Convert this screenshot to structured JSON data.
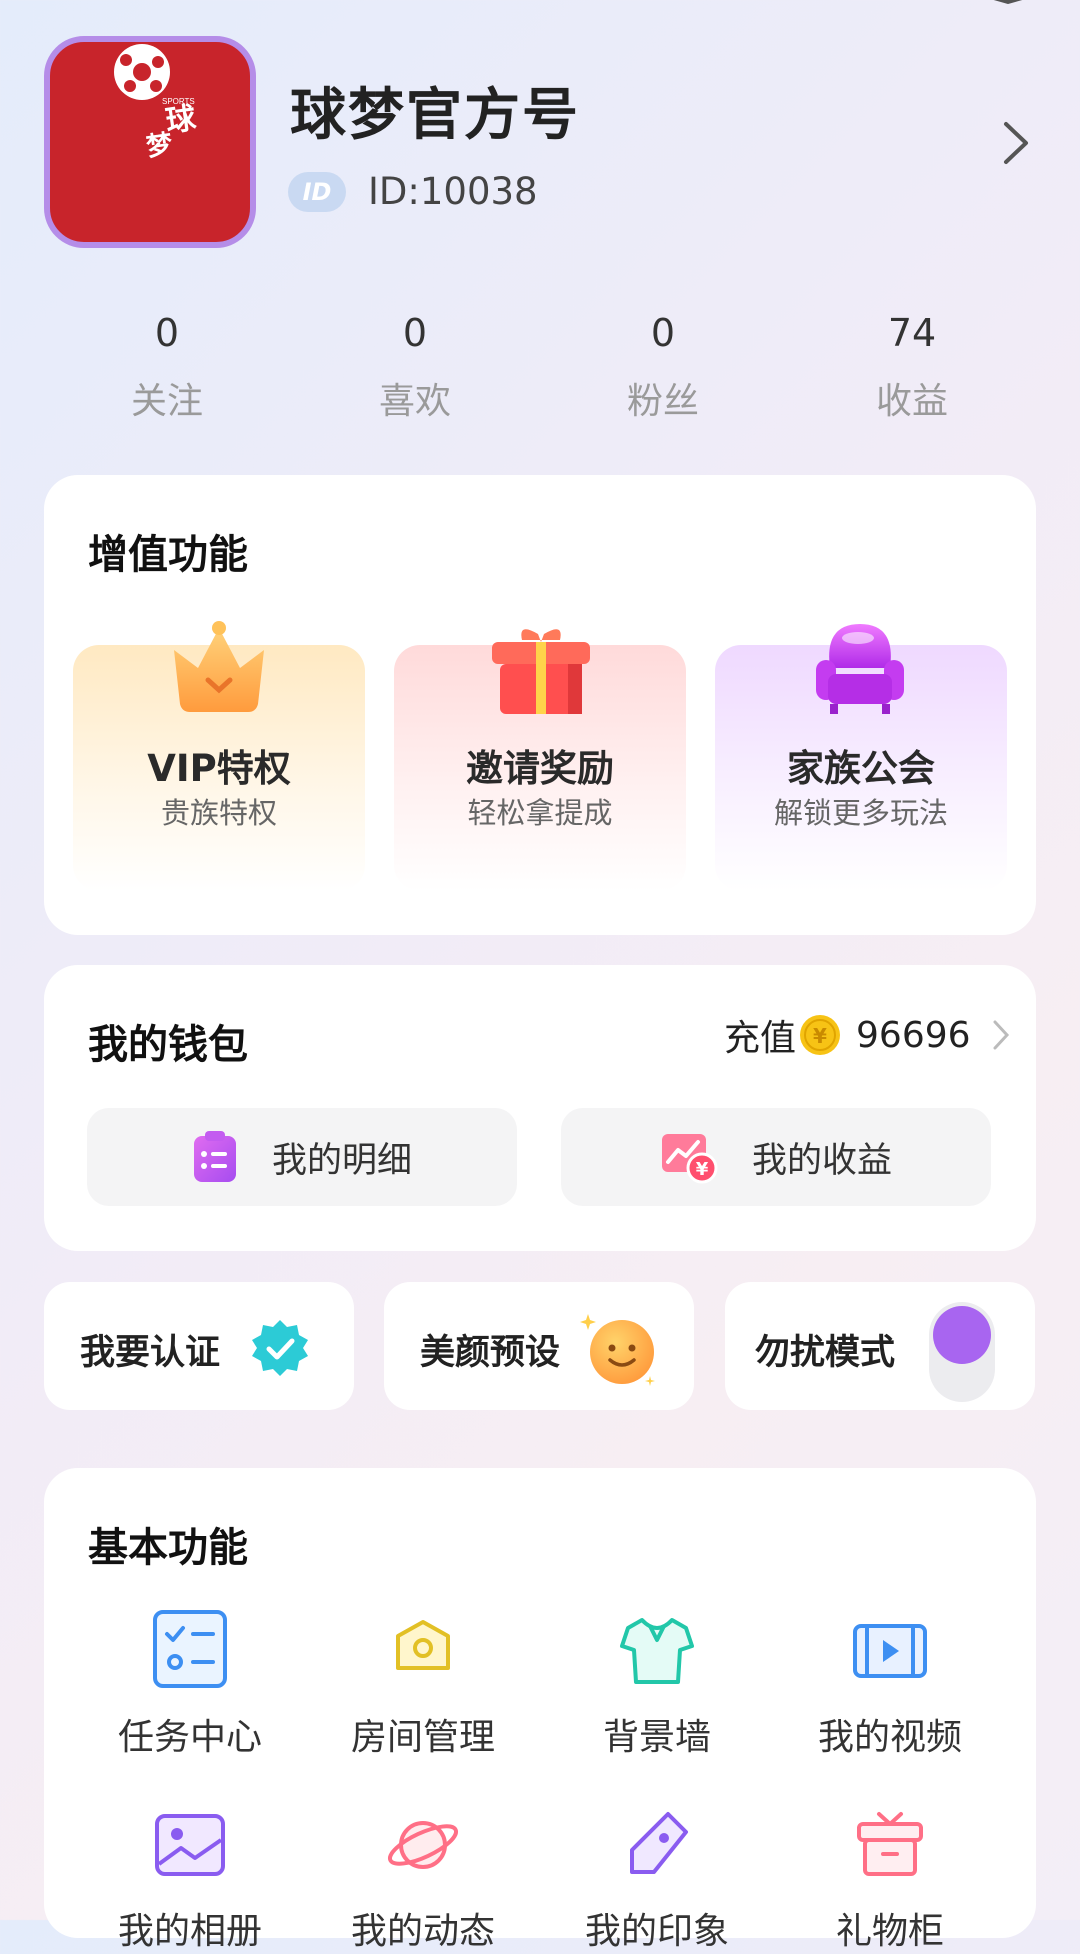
{
  "profile": {
    "name": "球梦官方号",
    "id_badge": "ID",
    "id_text": "ID:10038"
  },
  "stats": [
    {
      "value": "0",
      "label": "关注"
    },
    {
      "value": "0",
      "label": "喜欢"
    },
    {
      "value": "0",
      "label": "粉丝"
    },
    {
      "value": "74",
      "label": "收益"
    }
  ],
  "value_added": {
    "title": "增值功能",
    "items": [
      {
        "name": "VIP特权",
        "sub": "贵族特权",
        "icon": "crown-icon"
      },
      {
        "name": "邀请奖励",
        "sub": "轻松拿提成",
        "icon": "gift-icon"
      },
      {
        "name": "家族公会",
        "sub": "解锁更多玩法",
        "icon": "sofa-icon"
      }
    ]
  },
  "wallet": {
    "title": "我的钱包",
    "recharge_label": "充值",
    "balance": "96696",
    "buttons": [
      {
        "label": "我的明细",
        "icon": "clipboard-list-icon"
      },
      {
        "label": "我的收益",
        "icon": "earnings-chart-icon"
      }
    ]
  },
  "quick_tiles": [
    {
      "label": "我要认证",
      "icon": "verified-badge-icon"
    },
    {
      "label": "美颜预设",
      "icon": "smiley-face-icon"
    },
    {
      "label": "勿扰模式",
      "icon": "toggle-switch",
      "state": "off"
    }
  ],
  "basic": {
    "title": "基本功能",
    "items": [
      {
        "label": "任务中心",
        "icon": "task-list-icon"
      },
      {
        "label": "房间管理",
        "icon": "room-hexagon-icon"
      },
      {
        "label": "背景墙",
        "icon": "shirt-icon"
      },
      {
        "label": "我的视频",
        "icon": "video-film-icon"
      },
      {
        "label": "我的相册",
        "icon": "photo-album-icon"
      },
      {
        "label": "我的动态",
        "icon": "planet-icon"
      },
      {
        "label": "我的印象",
        "icon": "tag-pen-icon"
      },
      {
        "label": "礼物柜",
        "icon": "gift-cabinet-icon"
      }
    ]
  },
  "colors": {
    "accent_purple": "#a865f0",
    "avatar_red": "#c8242b",
    "coin_gold": "#f7c315"
  }
}
